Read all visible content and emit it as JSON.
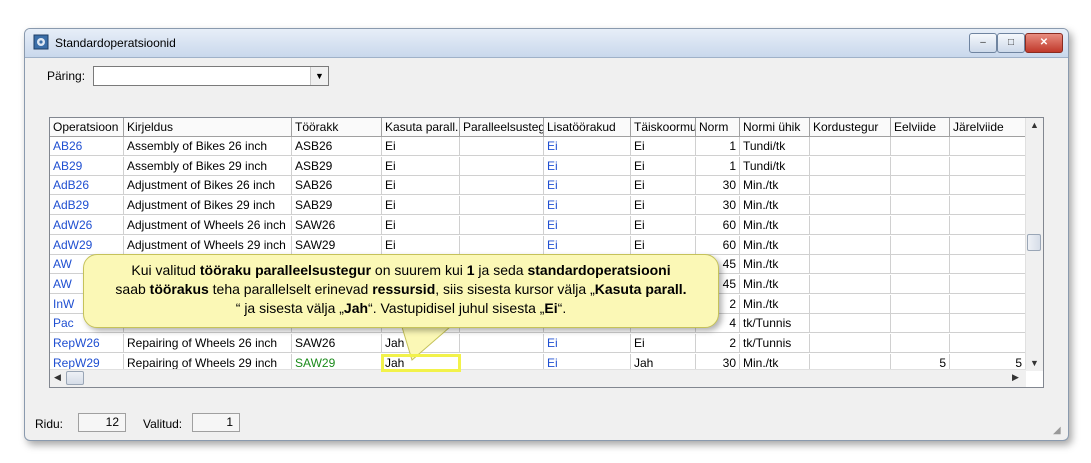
{
  "window": {
    "title": "Standardoperatsioonid",
    "minimize": "–",
    "maximize": "□",
    "close": "✕"
  },
  "query": {
    "label": "Päring:",
    "value": "",
    "arrow": "▼"
  },
  "columns": [
    "Operatsioon",
    "Kirjeldus",
    "Töörakk",
    "Kasuta parall.",
    "Paralleelsusteg",
    "Lisatöörakud",
    "Täiskoormu",
    "Norm",
    "Normi ühik",
    "Kordustegur",
    "Eelviide",
    "Järelviide"
  ],
  "rows": [
    [
      "AB26",
      "Assembly of Bikes 26 inch",
      "ASB26",
      "Ei",
      "",
      "Ei",
      "Ei",
      "1",
      "Tundi/tk",
      "",
      "",
      ""
    ],
    [
      "AB29",
      "Assembly of Bikes 29 inch",
      "ASB29",
      "Ei",
      "",
      "Ei",
      "Ei",
      "1",
      "Tundi/tk",
      "",
      "",
      ""
    ],
    [
      "AdB26",
      "Adjustment of Bikes 26 inch",
      "SAB26",
      "Ei",
      "",
      "Ei",
      "Ei",
      "30",
      "Min./tk",
      "",
      "",
      ""
    ],
    [
      "AdB29",
      "Adjustment of Bikes 29 inch",
      "SAB29",
      "Ei",
      "",
      "Ei",
      "Ei",
      "30",
      "Min./tk",
      "",
      "",
      ""
    ],
    [
      "AdW26",
      "Adjustment of Wheels 26 inch",
      "SAW26",
      "Ei",
      "",
      "Ei",
      "Ei",
      "60",
      "Min./tk",
      "",
      "",
      ""
    ],
    [
      "AdW29",
      "Adjustment of Wheels 29 inch",
      "SAW29",
      "Ei",
      "",
      "Ei",
      "Ei",
      "60",
      "Min./tk",
      "",
      "",
      ""
    ],
    [
      "AW",
      "",
      "",
      "",
      "",
      "",
      "",
      "45",
      "Min./tk",
      "",
      "",
      ""
    ],
    [
      "AW",
      "",
      "",
      "",
      "",
      "",
      "",
      "45",
      "Min./tk",
      "",
      "",
      ""
    ],
    [
      "InW",
      "",
      "",
      "",
      "",
      "",
      "",
      "2",
      "Min./tk",
      "",
      "",
      ""
    ],
    [
      "Pac",
      "",
      "",
      "",
      "",
      "",
      "",
      "4",
      "tk/Tunnis",
      "",
      "",
      ""
    ],
    [
      "RepW26",
      "Repairing of Wheels 26 inch",
      "SAW26",
      "Jah",
      "",
      "Ei",
      "Ei",
      "2",
      "tk/Tunnis",
      "",
      "",
      ""
    ],
    [
      "RepW29",
      "Repairing of Wheels 29 inch",
      "SAW29",
      "Jah",
      "",
      "Ei",
      "Jah",
      "30",
      "Min./tk",
      "",
      "5",
      "5"
    ]
  ],
  "status": {
    "rows_label": "Ridu:",
    "rows_value": "12",
    "selected_label": "Valitud:",
    "selected_value": "1"
  },
  "callout": {
    "p1": "Kui valitud ",
    "b1": "tööraku paralleelsustegur",
    "p2": " on suurem kui ",
    "b2": "1",
    "p3": " ja seda ",
    "b3": "standardoperatsiooni",
    "p4": " saab ",
    "b4": "töörakus",
    "p5": " teha parallelselt erinevad ",
    "b5": "ressursid",
    "p6": ", siis sisesta kursor välja „",
    "b6": "Kasuta parall.",
    "p7": "“ ja sisesta välja „",
    "b7": "Jah",
    "p8": "“.  Vastupidisel juhul sisesta „",
    "b8": "Ei",
    "p9": "“."
  },
  "colors": {
    "link": "#1f4fd1",
    "green": "#1a8a1a",
    "callout_bg": "#fbf8b6",
    "highlight": "#f2f24a"
  },
  "icons": {
    "app": "gear-window-icon",
    "resize": "resize-grip-icon"
  }
}
